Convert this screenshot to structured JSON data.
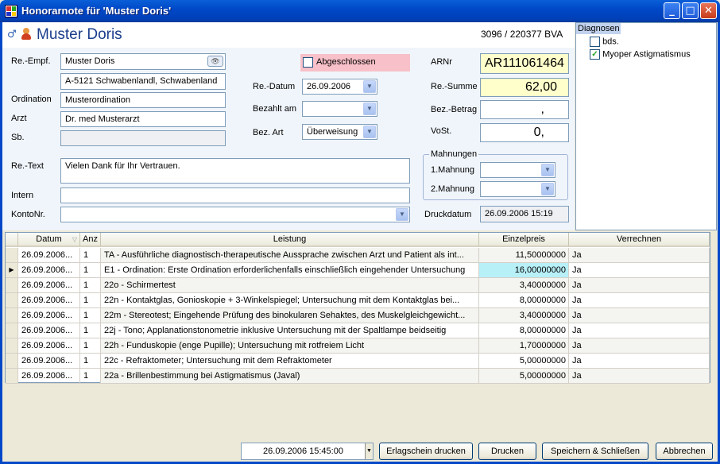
{
  "window": {
    "title": "Honorarnote für 'Muster Doris'"
  },
  "patient": {
    "name": "Muster Doris",
    "id": "3096 / 220377 BVA"
  },
  "form": {
    "re_empf_label": "Re.-Empf.",
    "re_empf_value": "Muster Doris",
    "address_value": "A-5121 Schwabenlandl, Schwabenland",
    "ordination_label": "Ordination",
    "ordination_value": "Musterordination",
    "arzt_label": "Arzt",
    "arzt_value": "Dr. med Musterarzt",
    "sb_label": "Sb.",
    "sb_value": "",
    "abgeschlossen_label": "Abgeschlossen",
    "re_datum_label": "Re.-Datum",
    "re_datum_value": "26.09.2006",
    "bezahlt_am_label": "Bezahlt am",
    "bezahlt_am_value": "",
    "bez_art_label": "Bez. Art",
    "bez_art_value": "Überweisung",
    "arnr_label": "ARNr",
    "arnr_value": "AR111061464",
    "re_summe_label": "Re.-Summe",
    "re_summe_value": "62,00",
    "bez_betrag_label": "Bez.-Betrag",
    "bez_betrag_value": ",",
    "vost_label": "VoSt.",
    "vost_value": "0,",
    "mahnungen_label": "Mahnungen",
    "mahnung1_label": "1.Mahnung",
    "mahnung2_label": "2.Mahnung",
    "re_text_label": "Re.-Text",
    "re_text_value": "Vielen Dank für Ihr Vertrauen.",
    "intern_label": "Intern",
    "kontonr_label": "KontoNr.",
    "druckdatum_label": "Druckdatum",
    "druckdatum_value": "26.09.2006 15:19"
  },
  "diagnosen": {
    "title": "Diagnosen",
    "items": [
      {
        "label": "bds.",
        "checked": false
      },
      {
        "label": "Myoper Astigmatismus",
        "checked": true
      }
    ]
  },
  "table": {
    "headers": [
      "Datum",
      "Anz",
      "Leistung",
      "Einzelpreis",
      "Verrechnen"
    ],
    "rows": [
      [
        "26.09.2006...",
        "1",
        "TA - Ausführliche diagnostisch-therapeutische Aussprache zwischen Arzt und Patient als int...",
        "11,50000000",
        "Ja"
      ],
      [
        "26.09.2006...",
        "1",
        "E1 - Ordination: Erste Ordination erforderlichenfalls einschließlich eingehender Untersuchung",
        "16,00000000",
        "Ja"
      ],
      [
        "26.09.2006...",
        "1",
        "22o - Schirmertest",
        "3,40000000",
        "Ja"
      ],
      [
        "26.09.2006...",
        "1",
        "22n - Kontaktglas, Gonioskopie + 3-Winkelspiegel; Untersuchung mit dem Kontaktglas bei...",
        "8,00000000",
        "Ja"
      ],
      [
        "26.09.2006...",
        "1",
        "22m - Stereotest; Eingehende Prüfung des binokularen Sehaktes, des Muskelgleichgewicht...",
        "3,40000000",
        "Ja"
      ],
      [
        "26.09.2006...",
        "1",
        "22j - Tono; Applanationstonometrie inklusive Untersuchung mit der Spaltlampe beidseitig",
        "8,00000000",
        "Ja"
      ],
      [
        "26.09.2006...",
        "1",
        "22h - Funduskopie (enge Pupille); Untersuchung mit rotfreiem Licht",
        "1,70000000",
        "Ja"
      ],
      [
        "26.09.2006...",
        "1",
        "22c - Refraktometer; Untersuchung mit dem Refraktometer",
        "5,00000000",
        "Ja"
      ],
      [
        "26.09.2006...",
        "1",
        "22a - Brillenbestimmung bei Astigmatismus (Javal)",
        "5,00000000",
        "Ja"
      ]
    ]
  },
  "footer": {
    "datetime": "26.09.2006 15:45:00",
    "erlagschein": "Erlagschein drucken",
    "drucken": "Drucken",
    "speichern": "Speichern & Schließen",
    "abbrechen": "Abbrechen"
  },
  "colors": {
    "selected_row": "#b8f0f8",
    "abgeschlossen_bg": "#f8c0c8",
    "yellow_field": "#ffffcc"
  }
}
